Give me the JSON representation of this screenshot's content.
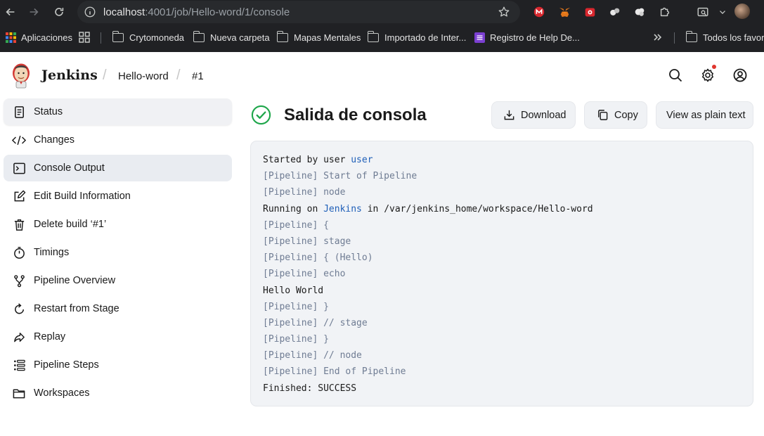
{
  "browser": {
    "url_host": "localhost",
    "url_path": ":4001/job/Hello-word/1/console",
    "bookmarks": [
      {
        "label": "Aplicaciones",
        "icon": "apps-grid-icon"
      },
      {
        "label": "Crytomoneda",
        "icon": "folder-icon"
      },
      {
        "label": "Nueva carpeta",
        "icon": "folder-icon"
      },
      {
        "label": "Mapas Mentales",
        "icon": "folder-icon"
      },
      {
        "label": "Importado de Inter...",
        "icon": "folder-icon"
      },
      {
        "label": "Registro de Help De...",
        "icon": "app-icon"
      },
      {
        "label": "Todos los favorit",
        "icon": "folder-icon"
      }
    ]
  },
  "header": {
    "brand": "Jenkins",
    "breadcrumbs": [
      "Hello-word",
      "#1"
    ]
  },
  "sidebar": {
    "items": [
      {
        "label": "Status",
        "icon": "document-icon"
      },
      {
        "label": "Changes",
        "icon": "code-icon"
      },
      {
        "label": "Console Output",
        "icon": "terminal-icon"
      },
      {
        "label": "Edit Build Information",
        "icon": "edit-icon"
      },
      {
        "label": "Delete build ‘#1’",
        "icon": "trash-icon"
      },
      {
        "label": "Timings",
        "icon": "stopwatch-icon"
      },
      {
        "label": "Pipeline Overview",
        "icon": "branch-icon"
      },
      {
        "label": "Restart from Stage",
        "icon": "restart-icon"
      },
      {
        "label": "Replay",
        "icon": "replay-icon"
      },
      {
        "label": "Pipeline Steps",
        "icon": "list-icon"
      },
      {
        "label": "Workspaces",
        "icon": "folder-icon"
      }
    ]
  },
  "main": {
    "title": "Salida de consola",
    "buttons": {
      "download": "Download",
      "copy": "Copy",
      "plain": "View as plain text"
    },
    "console": {
      "line0_prefix": "Started by user ",
      "line0_link": "user",
      "line1": "[Pipeline] Start of Pipeline",
      "line2": "[Pipeline] node",
      "line3_prefix": "Running on ",
      "line3_link": "Jenkins",
      "line3_suffix": " in /var/jenkins_home/workspace/Hello-word",
      "line4": "[Pipeline] {",
      "line5": "[Pipeline] stage",
      "line6": "[Pipeline] { (Hello)",
      "line7": "[Pipeline] echo",
      "line8": "Hello World",
      "line9": "[Pipeline] }",
      "line10": "[Pipeline] // stage",
      "line11": "[Pipeline] }",
      "line12": "[Pipeline] // node",
      "line13": "[Pipeline] End of Pipeline",
      "line14": "Finished: SUCCESS"
    }
  },
  "colors": {
    "success": "#1ea64a",
    "link": "#1f5fb8",
    "pipeline_text": "#6f7c93",
    "active_bg": "#e9ecf1"
  }
}
